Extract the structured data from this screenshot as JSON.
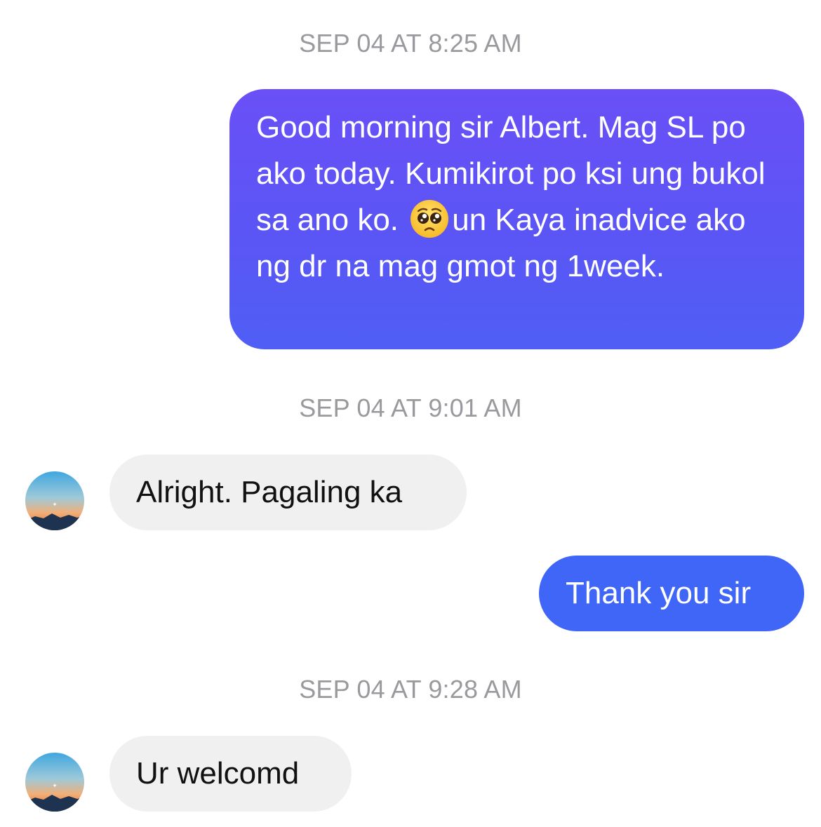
{
  "conversation": {
    "timestamps": {
      "t1": "SEP 04 AT 8:25 AM",
      "t2": "SEP 04 AT 9:01 AM",
      "t3": "SEP 04 AT 9:28 AM"
    },
    "messages": {
      "m1_part1": "Good morning sir Albert. Mag SL po ako today. Kumikirot po ksi ung bukol sa ano ko.",
      "m1_part2": "un Kaya inadvice ako ng dr na mag gmot ng 1week.",
      "m1_emoji": "pleading-face-emoji",
      "m2": "Alright. Pagaling ka",
      "m3": "Thank you sir",
      "m4": "Ur welcomd"
    }
  },
  "colors": {
    "outgoing_bubble_top": "#6a50f6",
    "outgoing_bubble_bottom": "#4f5ff5",
    "outgoing_bubble_solid": "#3f66f6",
    "incoming_bubble": "#f0f0f0",
    "timestamp_text": "#9a9a9e"
  }
}
